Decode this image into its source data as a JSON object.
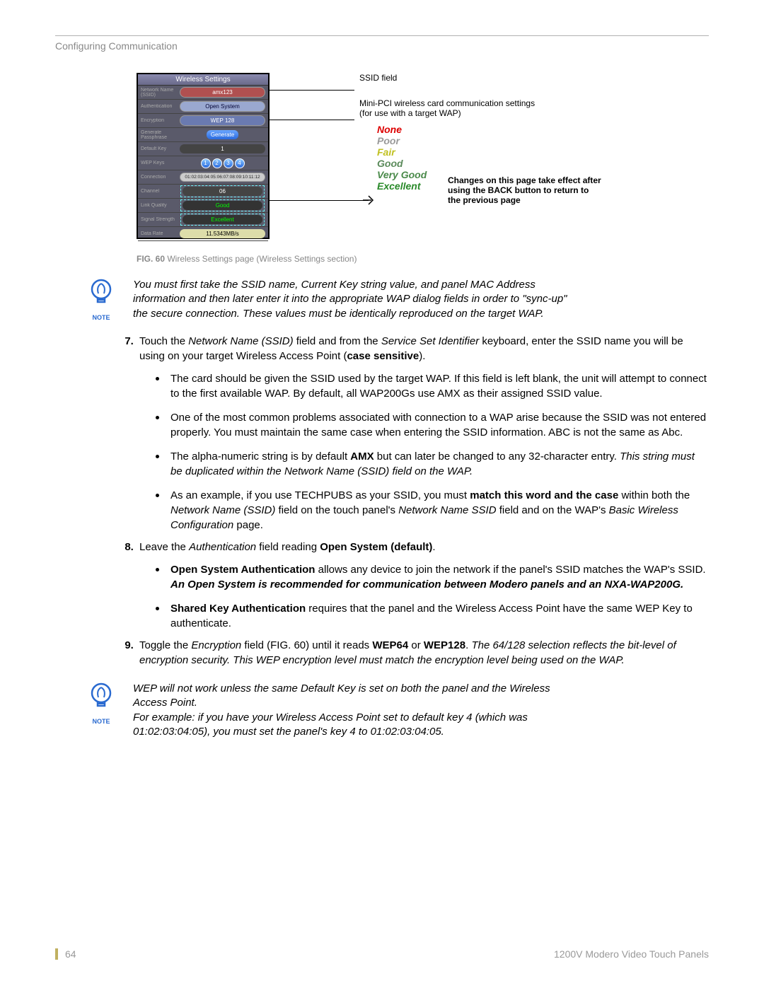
{
  "header": "Configuring Communication",
  "figure": {
    "panel_title": "Wireless Settings",
    "rows": {
      "ssid_label": "Network Name (SSID)",
      "ssid_value": "amx123",
      "auth_label": "Authentication",
      "auth_value": "Open System",
      "enc_label": "Encryption",
      "enc_value": "WEP 128",
      "gen_label": "Generate Passphrase",
      "gen_value": "Generate",
      "defkey_label": "Default Key",
      "defkey_value": "1",
      "wepkeys_label": "WEP Keys",
      "conn_label": "Connection",
      "conn_value": "01:02:03:04:05:06:07:08:09:10:11:12",
      "channel_label": "Channel",
      "channel_value": "06",
      "link_label": "Link Quality",
      "link_value": "Good",
      "sig_label": "Signal Strength",
      "sig_value": "Excellent",
      "rate_label": "Data Rate",
      "rate_value": "11.5343MB/s"
    },
    "callouts": {
      "ssid": "SSID field",
      "mini": "Mini-PCI wireless card communication settings (for use with a target WAP)",
      "change": "Changes on this page take effect after using the BACK button to return to the previous page"
    },
    "quality": {
      "none": "None",
      "poor": "Poor",
      "fair": "Fair",
      "good": "Good",
      "vgood": "Very Good",
      "excellent": "Excellent"
    },
    "caption_bold": "FIG. 60",
    "caption": "  Wireless Settings page (Wireless Settings section)"
  },
  "note1": "You must first take the SSID name, Current Key string value, and panel MAC Address information and then later enter it into the appropriate WAP dialog fields in order to \"sync-up\" the secure connection. These values must be identically reproduced on the target WAP.",
  "note_label": "NOTE",
  "list": {
    "item7": {
      "p1_a": "Touch the ",
      "p1_b": "Network Name (SSID)",
      "p1_c": " field and from the ",
      "p1_d": "Service Set Identifier",
      "p1_e": " keyboard, enter the SSID name you will be using on your target Wireless Access Point (",
      "p1_f": "case sensitive",
      "p1_g": ").",
      "b1": "The card should be given the SSID used by the target WAP. If this field is left blank, the unit will attempt to connect to the first available WAP. By default, all WAP200Gs use AMX as their assigned SSID value.",
      "b2": "One of the most common problems associated with connection to a WAP arise because the SSID was not entered properly. You must maintain the same case when entering the SSID information. ABC is not the same as Abc.",
      "b3_a": "The alpha-numeric string is by default ",
      "b3_b": "AMX",
      "b3_c": " but can later be changed to any 32-character entry. ",
      "b3_d": "This string must be duplicated within the Network Name (SSID) field on the WAP.",
      "b4_a": "As an example, if you use TECHPUBS as your SSID, you must ",
      "b4_b": "match this word and the case",
      "b4_c": " within both the ",
      "b4_d": "Network Name (SSID)",
      "b4_e": " field on the touch panel's ",
      "b4_f": "Network Name SSID",
      "b4_g": " field and on the WAP's ",
      "b4_h": "Basic Wireless Configuration",
      "b4_i": " page."
    },
    "item8": {
      "p1_a": "Leave the ",
      "p1_b": "Authentication",
      "p1_c": " field reading ",
      "p1_d": "Open System (default)",
      "p1_e": ".",
      "b1_a": "Open System Authentication",
      "b1_b": " allows any device to join the network if the panel's SSID matches the WAP's SSID. ",
      "b1_c": "An Open System is recommended for communication between Modero panels and an NXA-WAP200G.",
      "b2_a": "Shared Key Authentication",
      "b2_b": " requires that the panel and the Wireless Access Point have the same WEP Key to authenticate."
    },
    "item9": {
      "p1_a": "Toggle the ",
      "p1_b": "Encryption",
      "p1_c": " field (FIG. 60) until it reads ",
      "p1_d": "WEP64",
      "p1_e": " or ",
      "p1_f": "WEP128",
      "p1_g": ". ",
      "p1_h": "The 64/128 selection reflects the bit-level of encryption security. This WEP encryption level must match the encryption level being used on the WAP."
    }
  },
  "note2": "WEP will not work unless the same Default Key is set on both the panel and the Wireless Access Point.\nFor example: if you have your Wireless Access Point set to default key 4 (which was 01:02:03:04:05), you must set the panel's key 4 to 01:02:03:04:05.",
  "footer": {
    "page": "64",
    "title": "1200V Modero Video Touch Panels"
  }
}
